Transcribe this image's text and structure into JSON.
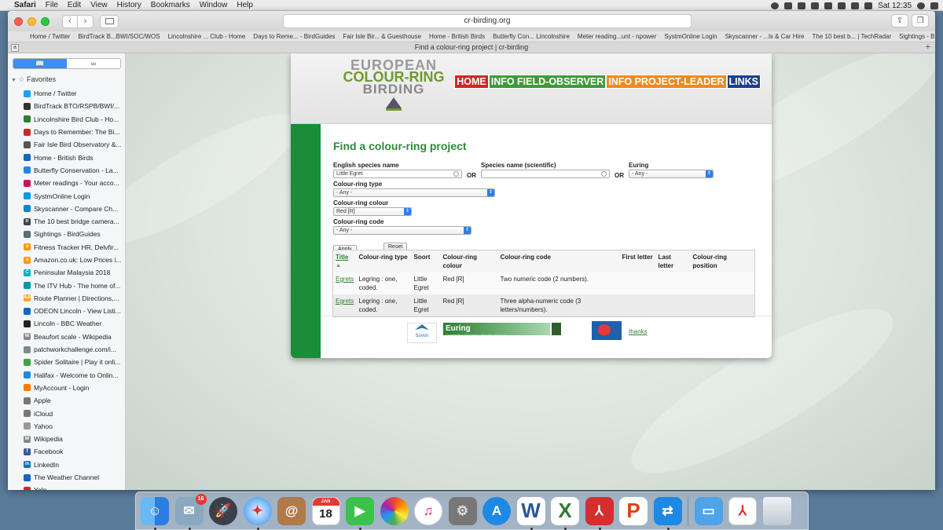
{
  "menubar": {
    "app": "Safari",
    "items": [
      "File",
      "Edit",
      "View",
      "History",
      "Bookmarks",
      "Window",
      "Help"
    ],
    "clock": "Sat 12:35"
  },
  "window": {
    "title": "Find a colour-ring project | cr-birding",
    "url": "cr-birding.org"
  },
  "bookmarks_bar": [
    "Home / Twitter",
    "BirdTrack B...BWI/SOC/WOS",
    "Lincolnshire ... Club - Home",
    "Days to Reme... - BirdGuides",
    "Fair Isle Bir... & Guesthouse",
    "Home - British Birds",
    "Butterfly Con... Lincolnshire",
    "Meter reading...unt - npower",
    "SystmOnline Login",
    "Skyscanner - ...ls & Car Hire",
    "The 10 best b... | TechRadar",
    "Sightings - BirdGuides"
  ],
  "tab_title": "Find a colour-ring project | cr-birding",
  "sidebar": {
    "header": "Favorites",
    "items": [
      {
        "label": "Home / Twitter",
        "color": "#1da1f2",
        "glyph": ""
      },
      {
        "label": "BirdTrack BTO/RSPB/BWI/...",
        "color": "#333333",
        "glyph": ""
      },
      {
        "label": "Lincolnshire Bird Club - Ho...",
        "color": "#2e7d32",
        "glyph": ""
      },
      {
        "label": "Days to Remember: The Bi...",
        "color": "#c62828",
        "glyph": ""
      },
      {
        "label": "Fair Isle Bird Observatory &...",
        "color": "#555555",
        "glyph": ""
      },
      {
        "label": "Home - British Birds",
        "color": "#1565c0",
        "glyph": ""
      },
      {
        "label": "Butterfly Conservation - La...",
        "color": "#1e88e5",
        "glyph": ""
      },
      {
        "label": "Meter readings - Your acco...",
        "color": "#c2185b",
        "glyph": ""
      },
      {
        "label": "SystmOnline Login",
        "color": "#039be5",
        "glyph": ""
      },
      {
        "label": "Skyscanner - Compare Ch...",
        "color": "#0288d1",
        "glyph": ""
      },
      {
        "label": "The 10 best bridge camera...",
        "color": "#37474f",
        "glyph": "tr"
      },
      {
        "label": "Sightings - BirdGuides",
        "color": "#546e7a",
        "glyph": ""
      },
      {
        "label": "Fitness Tracker HR, Delvfir...",
        "color": "#ff9800",
        "glyph": "a"
      },
      {
        "label": "Amazon.co.uk: Low Prices i...",
        "color": "#ff9800",
        "glyph": "a"
      },
      {
        "label": "Peninsular Malaysia 2018",
        "color": "#00acc1",
        "glyph": "C"
      },
      {
        "label": "The ITV Hub - The home of...",
        "color": "#0097a7",
        "glyph": ""
      },
      {
        "label": "Route Planner | Directions,...",
        "color": "#f9a825",
        "glyph": "AA"
      },
      {
        "label": "ODEON Lincoln - View Listi...",
        "color": "#1565c0",
        "glyph": ""
      },
      {
        "label": "Lincoln - BBC Weather",
        "color": "#222222",
        "glyph": ""
      },
      {
        "label": "Beaufort scale - Wikipedia",
        "color": "#888888",
        "glyph": "W"
      },
      {
        "label": "patchworkchallenge.com/i...",
        "color": "#7b8a8b",
        "glyph": ""
      },
      {
        "label": "Spider Solitaire | Play it onli...",
        "color": "#43a047",
        "glyph": ""
      },
      {
        "label": "Halifax - Welcome to Onlin...",
        "color": "#1e88e5",
        "glyph": ""
      },
      {
        "label": "MyAccount - Login",
        "color": "#f57c00",
        "glyph": ""
      },
      {
        "label": "Apple",
        "color": "#777777",
        "glyph": ""
      },
      {
        "label": "iCloud",
        "color": "#777777",
        "glyph": ""
      },
      {
        "label": "Yahoo",
        "color": "#999999",
        "glyph": ""
      },
      {
        "label": "Wikipedia",
        "color": "#888888",
        "glyph": "W"
      },
      {
        "label": "Facebook",
        "color": "#3b5998",
        "glyph": "f"
      },
      {
        "label": "LinkedIn",
        "color": "#0077b5",
        "glyph": "in"
      },
      {
        "label": "The Weather Channel",
        "color": "#1565c0",
        "glyph": ""
      },
      {
        "label": "Yelp",
        "color": "#d32323",
        "glyph": ""
      }
    ]
  },
  "site": {
    "logo": {
      "line1": "EUROPEAN",
      "line2": "COLOUR-RING",
      "line3": "BIRDING"
    },
    "nav": {
      "home": "HOME",
      "observer": "INFO FIELD-OBSERVER",
      "leader": "INFO PROJECT-LEADER",
      "links": "LINKS"
    },
    "heading": "Find a colour-ring project",
    "form": {
      "english_label": "English species name",
      "english_value": "Little Egret",
      "or1": "OR",
      "scientific_label": "Species name (scientific)",
      "scientific_value": "",
      "or2": "OR",
      "euring_label": "Euring",
      "euring_value": "- Any -",
      "type_label": "Colour-ring type",
      "type_value": "- Any -",
      "colour_label": "Colour-ring colour",
      "colour_value": "Red [R]",
      "code_label": "Colour-ring code",
      "code_value": "- Any -",
      "apply": "Apply",
      "reset": "Reset"
    },
    "table": {
      "headers": [
        "Title",
        "Colour-ring type",
        "Soort",
        "Colour-ring colour",
        "Colour-ring code",
        "First letter",
        "Last letter",
        "Colour-ring position"
      ],
      "rows": [
        {
          "title": "Egrets",
          "type": "Legring : one, coded.",
          "soort": "Little Egret",
          "colour": "Red [R]",
          "code": "Two numeric code (2 numbers).",
          "first": "",
          "last": "",
          "position": ""
        },
        {
          "title": "Egrets",
          "type": "Legring : one, coded.",
          "soort": "Little Egret",
          "colour": "Red [R]",
          "code": "Three alpha-numeric code (3 letters/numbers).",
          "first": "",
          "last": "",
          "position": ""
        }
      ]
    },
    "footer": {
      "sovon": "Sovon",
      "euring": "Euring",
      "euring_sub": "Coordinating bird ringing throughout Europe",
      "thanks": "thanks"
    }
  },
  "dock": {
    "mail_badge": "16",
    "calendar_month": "JAN",
    "calendar_day": "18",
    "apps": [
      "finder-icon",
      "mail-icon",
      "launchpad-icon",
      "safari-icon",
      "contacts-icon",
      "calendar-icon",
      "facetime-icon",
      "photos-icon",
      "itunes-icon",
      "system-preferences-icon",
      "app-store-icon",
      "word-icon",
      "excel-icon",
      "acrobat-icon",
      "powerpoint-icon",
      "teamviewer-icon",
      "downloads-folder-icon",
      "pdf-icon",
      "trash-icon"
    ]
  }
}
